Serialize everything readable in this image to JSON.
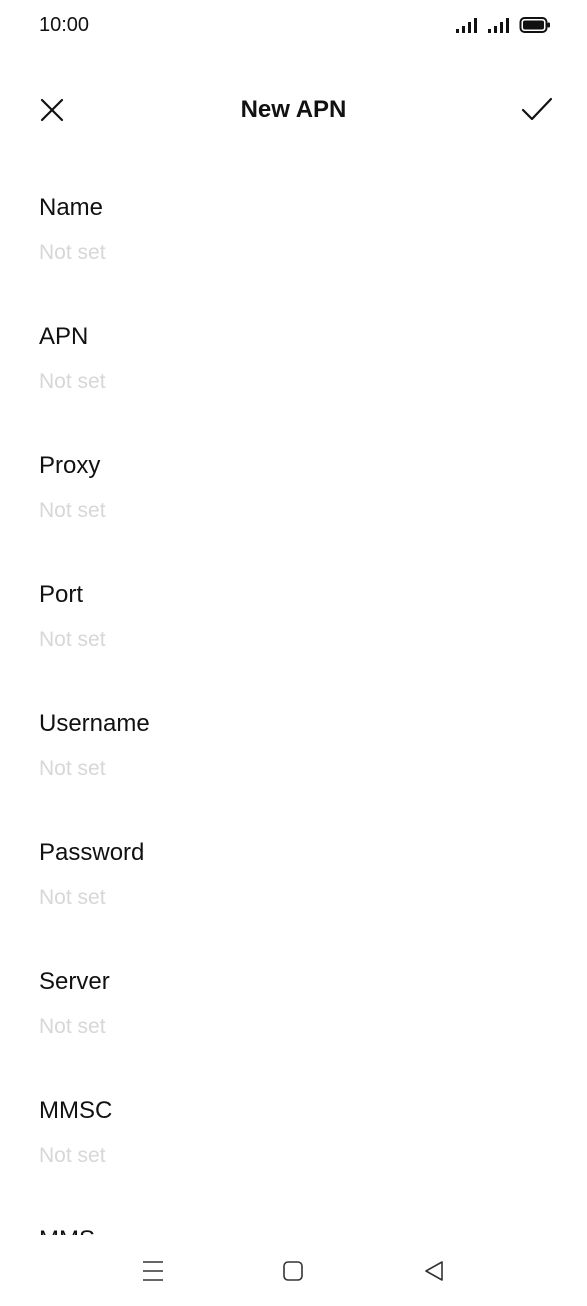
{
  "status_bar": {
    "time": "10:00",
    "icons": [
      "signal-icon",
      "signal-icon",
      "battery-icon"
    ]
  },
  "header": {
    "title": "New APN",
    "close_icon": "close-icon",
    "confirm_icon": "check-icon"
  },
  "fields": [
    {
      "label": "Name",
      "value": "Not set"
    },
    {
      "label": "APN",
      "value": "Not set"
    },
    {
      "label": "Proxy",
      "value": "Not set"
    },
    {
      "label": "Port",
      "value": "Not set"
    },
    {
      "label": "Username",
      "value": "Not set"
    },
    {
      "label": "Password",
      "value": "Not set"
    },
    {
      "label": "Server",
      "value": "Not set"
    },
    {
      "label": "MMSC",
      "value": "Not set"
    },
    {
      "label": "MMS",
      "value": ""
    }
  ],
  "nav_bar": {
    "icons": [
      "menu-icon",
      "home-icon",
      "back-icon"
    ]
  },
  "colors": {
    "background": "#ffffff",
    "text_primary": "#111111",
    "text_placeholder": "#d7d7d7"
  }
}
